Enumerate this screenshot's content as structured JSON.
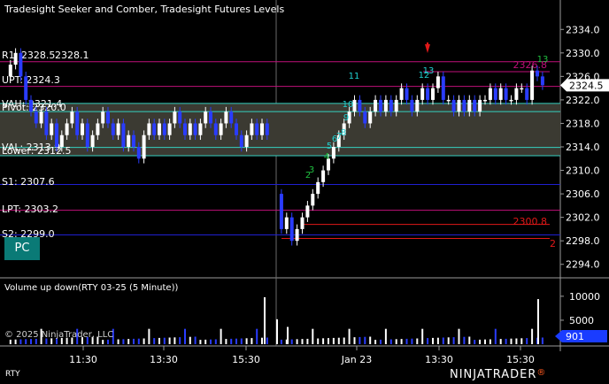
{
  "chart_title": "Tradesight Seeker and Comber, Tradesight Futures Levels",
  "instrument": "RTY",
  "pc_button": "PC",
  "volume_title": "Volume up down(RTY 03-25 (5 Minute))",
  "copyright": "© 2025 NinjaTrader, LLC",
  "brand": {
    "name": "NINJATRADER",
    "mark": "®"
  },
  "colors": {
    "up": "#ffffff",
    "down": "#2a3cff",
    "level_magenta": "#c0107a",
    "level_blue": "#2020d0",
    "level_cyan": "#35d0c0",
    "level_red": "#e01818",
    "seq_cyan": "#20d0d0",
    "seq_green": "#20c040",
    "price_tag": "#ffffff",
    "vol_tag": "#1a3cff"
  },
  "price_axis": {
    "labels": [
      "2334.0",
      "2330.0",
      "2326.0",
      "2322.0",
      "2318.0",
      "2314.0",
      "2310.0",
      "2306.0",
      "2302.0",
      "2298.0",
      "2294.0"
    ],
    "current": "2324.5"
  },
  "volume_axis": {
    "labels": [
      "10000",
      "5000"
    ],
    "current": "901"
  },
  "time_axis": {
    "labels": [
      "11:30",
      "13:30",
      "15:30",
      "Jan 23",
      "13:30",
      "15:30"
    ]
  },
  "levels": [
    {
      "name": "R1",
      "text": "R1: 2328.5",
      "extra": "2328.1"
    },
    {
      "name": "UPT",
      "text": "UPT: 2324.3"
    },
    {
      "name": "VAH",
      "text": "VAH: 2321.4"
    },
    {
      "name": "Pivot",
      "text": "Pivot: 2320.0"
    },
    {
      "name": "VAL",
      "text": "VAL: 2313.9"
    },
    {
      "name": "Lower",
      "text": "Lower: 2312.5"
    },
    {
      "name": "S1",
      "text": "S1: 2307.6"
    },
    {
      "name": "LPT",
      "text": "LPT: 2303.2"
    },
    {
      "name": "S2",
      "text": "S2: 2299.0"
    }
  ],
  "annotations": {
    "red_level_right": "2300.8",
    "magenta_level_right": "2326.8",
    "edge_label": "2",
    "seq_top": "13",
    "seq_top2": "12",
    "seq_far": "13",
    "seq_11": "11",
    "seq_left_top": "10",
    "seq_9": "9"
  },
  "chart_data": {
    "type": "candlestick",
    "title": "Tradesight Seeker and Comber, Tradesight Futures Levels",
    "instrument": "RTY 03-25 (5 Minute)",
    "y_range": [
      2292,
      2336
    ],
    "volume_range": [
      0,
      12000
    ],
    "x_ticks": [
      "11:30",
      "13:30",
      "15:30",
      "Jan 23",
      "13:30",
      "15:30"
    ],
    "last_price": 2324.5,
    "last_volume": 901,
    "levels": [
      {
        "name": "R1",
        "value": 2328.5
      },
      {
        "name": "UPT",
        "value": 2324.3
      },
      {
        "name": "VAH",
        "value": 2321.4
      },
      {
        "name": "Pivot",
        "value": 2320.0
      },
      {
        "name": "VAL",
        "value": 2313.9
      },
      {
        "name": "Lower",
        "value": 2312.5
      },
      {
        "name": "S1",
        "value": 2307.6
      },
      {
        "name": "LPT",
        "value": 2303.2
      },
      {
        "name": "S2",
        "value": 2299.0
      }
    ],
    "right_levels": [
      {
        "value": 2326.8,
        "label": "2326.8"
      },
      {
        "value": 2300.8,
        "label": "2300.8"
      }
    ]
  }
}
